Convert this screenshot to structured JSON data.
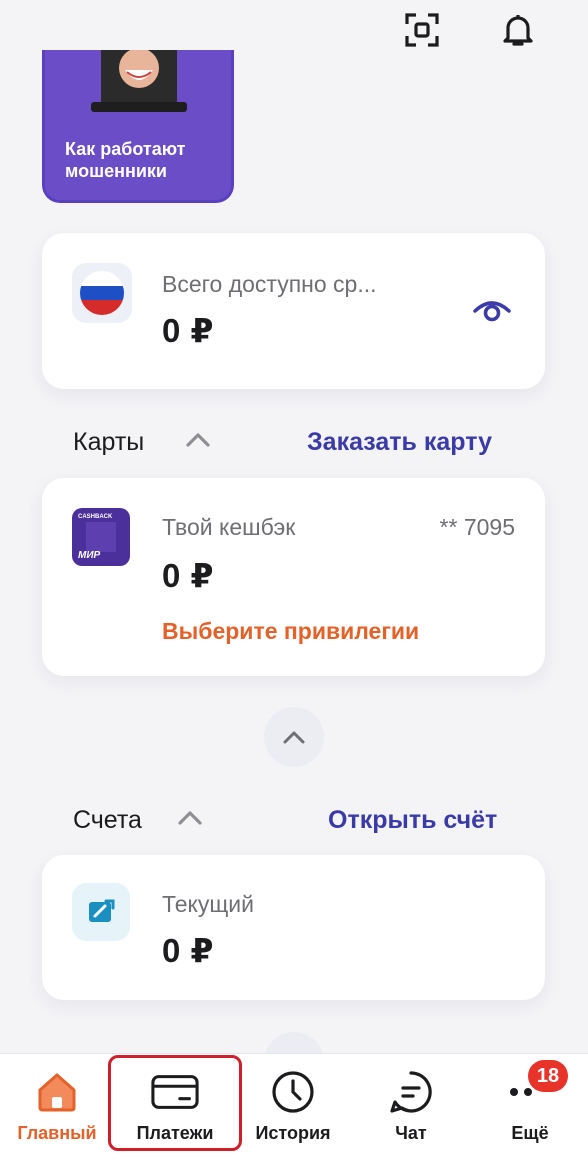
{
  "story": {
    "title": "Как работают мошенники"
  },
  "total": {
    "label": "Всего доступно ср...",
    "amount": "0 ₽"
  },
  "cards_section": {
    "title": "Карты",
    "action": "Заказать карту"
  },
  "card": {
    "thumb_brand": "CASHBACK",
    "thumb_system": "МИР",
    "name": "Твой кешбэк",
    "number": "** 7095",
    "amount": "0 ₽",
    "privilege": "Выберите привилегии"
  },
  "accounts_section": {
    "title": "Счета",
    "action": "Открыть счёт"
  },
  "account": {
    "name": "Текущий",
    "amount": "0 ₽"
  },
  "nav": {
    "home": "Главный",
    "payments": "Платежи",
    "history": "История",
    "chat": "Чат",
    "more": "Ещё",
    "more_badge": "18"
  },
  "colors": {
    "accent": "#3a3aa8",
    "orange": "#e4622a",
    "badge": "#e8332a",
    "highlight": "#d01f2a"
  }
}
